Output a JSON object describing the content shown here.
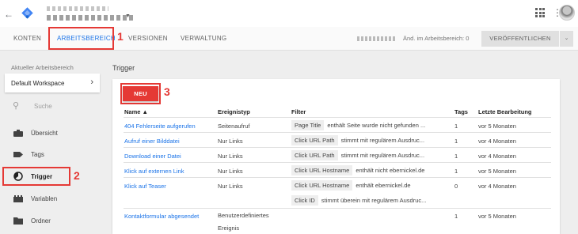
{
  "header": {
    "back_icon": "arrow-left-icon",
    "account_text": "",
    "container_text": ""
  },
  "tabs": {
    "konten": "KONTEN",
    "arbeitsbereich": "ARBEITSBEREICH",
    "versionen": "VERSIONEN",
    "verwaltung": "VERWALTUNG"
  },
  "annotations": {
    "n1": "1",
    "n2": "2",
    "n3": "3"
  },
  "toolbar": {
    "changes": "Änd. im Arbeitsbereich: 0",
    "publish": "VERÖFFENTLICHEN"
  },
  "sidebar": {
    "workspace_label": "Aktueller Arbeitsbereich",
    "workspace_name": "Default Workspace",
    "search_placeholder": "Suche",
    "items": [
      {
        "label": "Übersicht",
        "icon": "briefcase-icon"
      },
      {
        "label": "Tags",
        "icon": "tag-icon"
      },
      {
        "label": "Trigger",
        "icon": "trigger-icon"
      },
      {
        "label": "Variablen",
        "icon": "variables-icon"
      },
      {
        "label": "Ordner",
        "icon": "folder-icon"
      }
    ]
  },
  "main": {
    "title": "Trigger",
    "new_button": "NEU",
    "columns": {
      "name": "Name ▲",
      "event": "Ereignistyp",
      "filter": "Filter",
      "tags": "Tags",
      "last": "Letzte Bearbeitung"
    },
    "rows": [
      {
        "name": "404 Fehlerseite aufgerufen",
        "event": "Seitenaufruf",
        "filters": [
          {
            "key": "Page Title",
            "text": "enthält Seite wurde nicht gefunden ..."
          }
        ],
        "tags": "1",
        "last": "vor 5 Monaten"
      },
      {
        "name": "Aufruf einer Bilddatei",
        "event": "Nur Links",
        "filters": [
          {
            "key": "Click URL Path",
            "text": "stimmt mit regulärem Ausdruc..."
          }
        ],
        "tags": "1",
        "last": "vor 4 Monaten"
      },
      {
        "name": "Download einer Datei",
        "event": "Nur Links",
        "filters": [
          {
            "key": "Click URL Path",
            "text": "stimmt mit regulärem Ausdruc..."
          }
        ],
        "tags": "1",
        "last": "vor 4 Monaten"
      },
      {
        "name": "Klick auf externen Link",
        "event": "Nur Links",
        "filters": [
          {
            "key": "Click URL Hostname",
            "text": "enthält nicht ebernickel.de"
          }
        ],
        "tags": "1",
        "last": "vor 5 Monaten"
      },
      {
        "name": "Klick auf Teaser",
        "event": "Nur Links",
        "filters": [
          {
            "key": "Click URL Hostname",
            "text": "enthält ebernickel.de"
          },
          {
            "key": "Click ID",
            "text": "stimmt überein mit regulärem Ausdruc..."
          }
        ],
        "tags": "0",
        "last": "vor 4 Monaten"
      },
      {
        "name": "Kontaktformular abgesendet",
        "event": "Benutzerdefiniertes Ereignis",
        "filters": [],
        "tags": "1",
        "last": "vor 5 Monaten"
      }
    ]
  },
  "colors": {
    "accent": "#1a73e8",
    "annotation": "#e53935"
  }
}
